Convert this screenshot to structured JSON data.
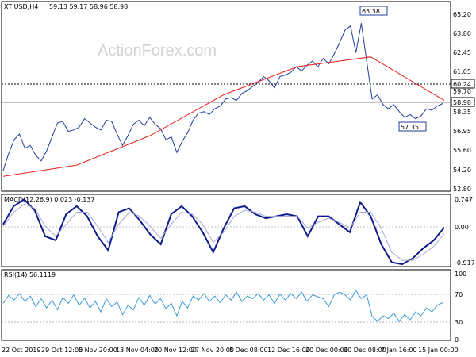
{
  "colors": {
    "price": "#1f3c9e",
    "ma": "#e8201a",
    "macd": "#0f1a8a",
    "signal": "#a5a8d8",
    "rsi": "#3a9ad9"
  },
  "chart_data": [
    {
      "type": "line",
      "title": "XTIUSD,H4  59.13 59.17 58.96 58.98",
      "symbol": "XTIUSD,H4",
      "ohlc_readout": "59.13 59.17 58.96 58.98",
      "watermark": "ActionForex.com",
      "yticks": [
        "65.20",
        "63.80",
        "62.45",
        "61.05",
        "59.70",
        "58.35",
        "56.95",
        "55.60",
        "54.20",
        "52.80"
      ],
      "ylim": [
        52.8,
        65.9
      ],
      "x": [
        "22 Oct 2019",
        "29 Oct 12:00",
        "5 Nov 20:00",
        "13 Nov 04:00",
        "20 Nov 12:00",
        "27 Nov 20:00",
        "5 Dec 08:00",
        "12 Dec 16:00",
        "20 Dec 00:00",
        "30 Dec 08:00",
        "7 Jan 16:00",
        "15 Jan 00:00"
      ],
      "series": [
        {
          "key": "price",
          "values": [
            54.2,
            55.4,
            56.4,
            56.8,
            55.8,
            56.0,
            55.3,
            54.9,
            55.6,
            56.6,
            57.6,
            57.7,
            57.0,
            57.1,
            57.3,
            57.9,
            57.6,
            57.3,
            57.1,
            57.8,
            57.7,
            56.8,
            56.0,
            56.7,
            57.5,
            57.8,
            57.4,
            58.0,
            57.5,
            57.2,
            56.4,
            56.6,
            55.5,
            56.3,
            56.9,
            57.8,
            58.3,
            58.4,
            58.2,
            58.6,
            58.8,
            59.3,
            59.4,
            59.2,
            59.7,
            59.9,
            60.2,
            60.5,
            60.9,
            60.6,
            60.1,
            60.9,
            61.0,
            61.2,
            61.6,
            61.3,
            61.7,
            62.0,
            61.6,
            62.2,
            61.8,
            62.5,
            63.3,
            64.2,
            64.5,
            62.6,
            64.7,
            62.0,
            59.3,
            59.6,
            58.9,
            58.6,
            58.9,
            58.4,
            58.0,
            58.2,
            57.9,
            58.1,
            58.6,
            58.5,
            58.8,
            58.98
          ]
        },
        {
          "key": "ma",
          "values": [
            53.8,
            54.6,
            56.7,
            59.6,
            61.6,
            62.3,
            59.2
          ]
        }
      ],
      "labels": {
        "high": "65.38",
        "low": "57.35",
        "level": "60.24",
        "last": "58.98"
      },
      "annotations": [
        {
          "text": "65.38",
          "x": "7 Jan 00:00",
          "y": 65.38
        },
        {
          "text": "57.35",
          "x": "14 Jan 00:00",
          "y": 57.35
        }
      ],
      "hlines": [
        60.24,
        58.98
      ]
    },
    {
      "type": "line",
      "title": "MACD(12,26,9) 0.023 -0.137",
      "yticks": [
        "0.747",
        "0.00",
        "-0.917"
      ],
      "ylim": [
        -0.917,
        0.747
      ],
      "series": [
        {
          "key": "macd",
          "values": [
            0.1,
            0.55,
            0.72,
            0.45,
            -0.2,
            -0.3,
            0.35,
            0.55,
            0.3,
            -0.2,
            -0.55,
            0.4,
            0.5,
            0.2,
            -0.15,
            -0.4,
            0.35,
            0.55,
            0.3,
            -0.1,
            -0.6,
            0.0,
            0.5,
            0.55,
            0.35,
            0.25,
            0.3,
            0.35,
            0.3,
            -0.2,
            0.3,
            0.3,
            0.1,
            -0.1,
            0.65,
            0.3,
            -0.4,
            -0.85,
            -0.9,
            -0.75,
            -0.5,
            -0.3,
            0.02
          ]
        },
        {
          "key": "signal",
          "values": [
            0.05,
            0.4,
            0.6,
            0.5,
            0.05,
            -0.2,
            0.1,
            0.4,
            0.4,
            0.05,
            -0.35,
            0.1,
            0.4,
            0.3,
            0.05,
            -0.25,
            0.1,
            0.4,
            0.35,
            0.1,
            -0.35,
            -0.1,
            0.3,
            0.45,
            0.4,
            0.3,
            0.3,
            0.3,
            0.3,
            0.0,
            0.15,
            0.25,
            0.15,
            0.0,
            0.4,
            0.4,
            0.0,
            -0.6,
            -0.8,
            -0.8,
            -0.65,
            -0.45,
            -0.14
          ]
        }
      ]
    },
    {
      "type": "line",
      "title": "RSI(14) 56.1119",
      "yticks": [
        "100",
        "70",
        "30",
        "0"
      ],
      "ylim": [
        0,
        100
      ],
      "series": [
        {
          "key": "rsi",
          "values": [
            55,
            67,
            60,
            70,
            58,
            66,
            50,
            62,
            48,
            60,
            45,
            64,
            55,
            68,
            52,
            63,
            48,
            58,
            42,
            62,
            50,
            57,
            38,
            52,
            45,
            64,
            52,
            67,
            54,
            62,
            47,
            55,
            36,
            58,
            48,
            66,
            60,
            70,
            58,
            66,
            56,
            68,
            60,
            72,
            58,
            66,
            62,
            70,
            60,
            68,
            55,
            69,
            60,
            70,
            62,
            72,
            58,
            68,
            65,
            62,
            50,
            68,
            72,
            68,
            60,
            75,
            62,
            68,
            35,
            28,
            36,
            32,
            40,
            28,
            38,
            30,
            42,
            36,
            48,
            42,
            52,
            56
          ]
        }
      ]
    }
  ]
}
